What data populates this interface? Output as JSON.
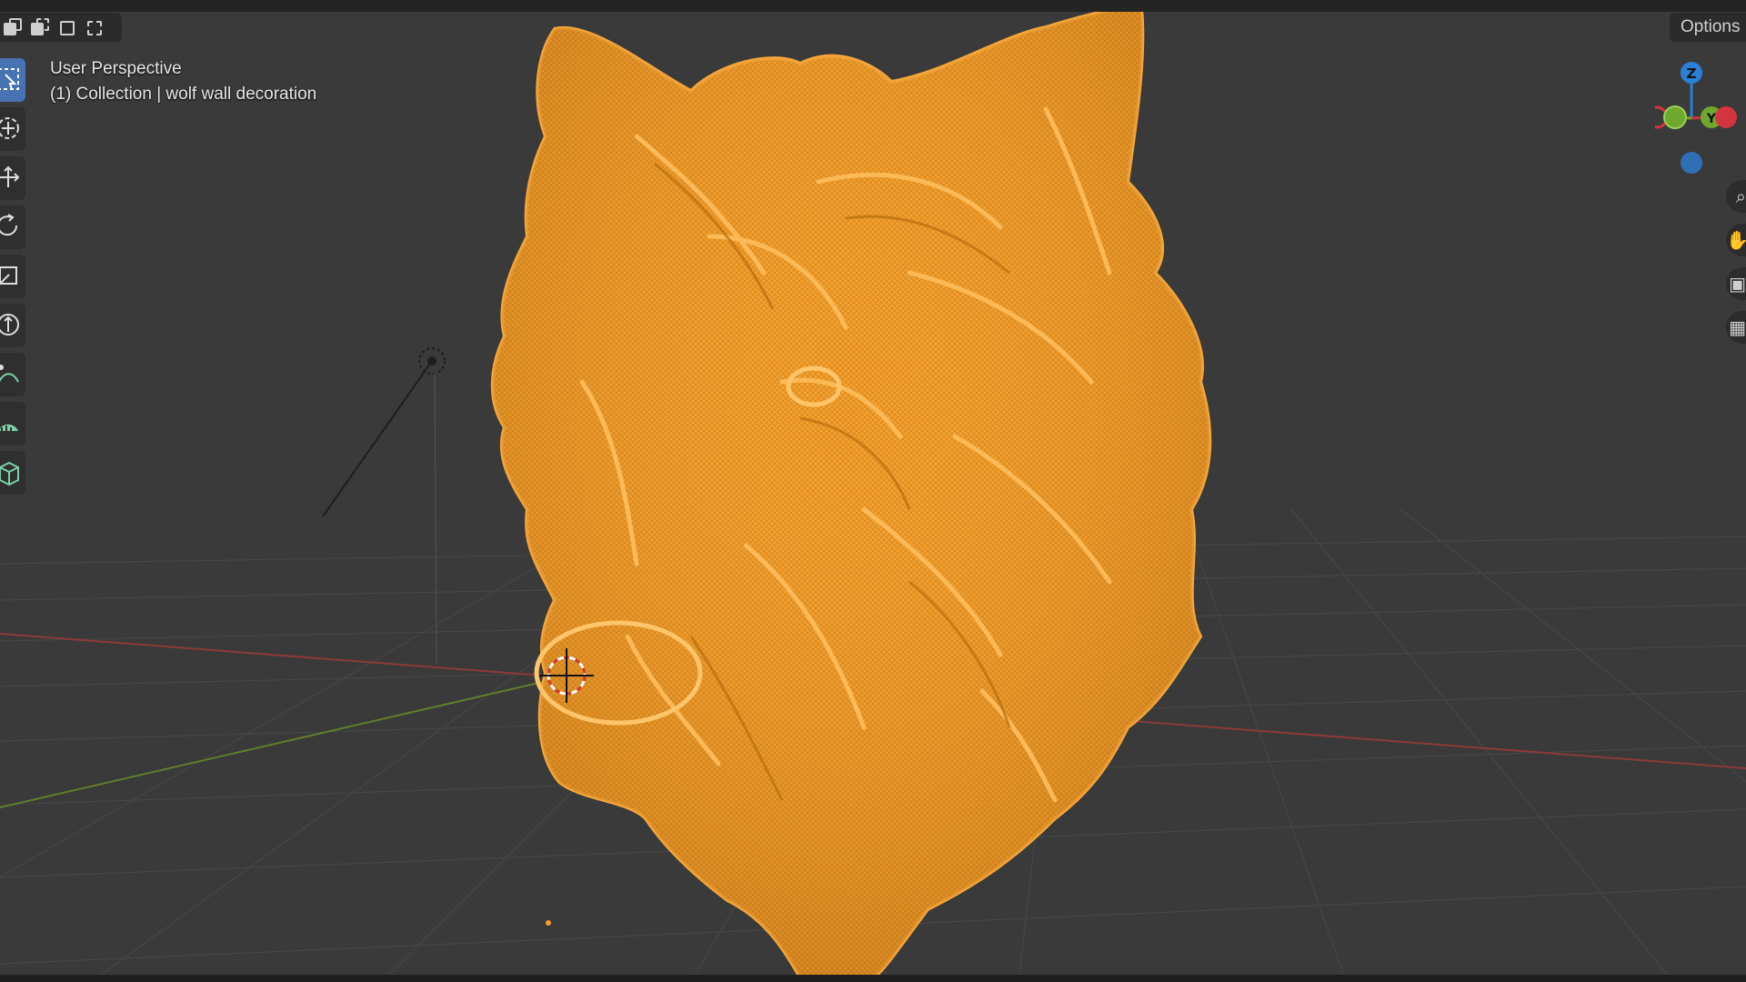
{
  "viewport": {
    "view_label": "User Perspective",
    "collection_label": "(1) Collection | wolf wall decoration"
  },
  "header": {
    "options_label": "Options"
  },
  "gizmo": {
    "z_label": "Z",
    "y_label": "Y"
  },
  "toolbar": {
    "tools": [
      "select-box-icon",
      "cursor-icon",
      "move-icon",
      "rotate-icon",
      "scale-icon",
      "transform-icon",
      "annotate-icon",
      "measure-icon",
      "add-cube-icon"
    ]
  },
  "colors": {
    "background": "#3a3a3a",
    "grid": "#474747",
    "x_axis": "#8c3a3a",
    "y_axis": "#5f7f2a",
    "selection": "#f5a030",
    "active_tool": "#4772b3",
    "gizmo_z": "#2a7fd6",
    "gizmo_y": "#6ea82c",
    "gizmo_x": "#d4343f"
  }
}
